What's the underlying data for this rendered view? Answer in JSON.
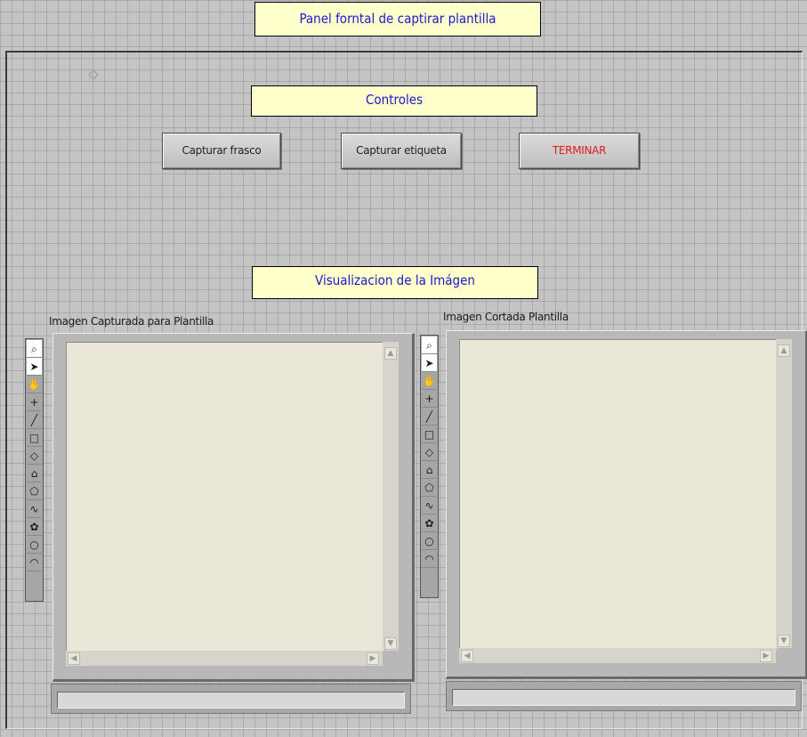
{
  "header": {
    "title": "Panel forntal de captirar plantilla"
  },
  "controls": {
    "section_title": "Controles",
    "buttons": {
      "capture_bottle": "Capturar frasco",
      "capture_label": "Capturar etiqueta",
      "terminate": "TERMINAR"
    },
    "terminate_color": "#e21a1a"
  },
  "visualization": {
    "section_title": "Visualizacion de la Imágen",
    "left_caption": "Imagen Capturada para  Plantilla",
    "right_caption": "Imagen Cortada Plantilla"
  },
  "toolbar_tools": [
    {
      "name": "zoom-icon",
      "glyph": "⌕"
    },
    {
      "name": "select-pointer-icon",
      "glyph": "➤"
    },
    {
      "name": "pan-hand-icon",
      "glyph": "✋"
    },
    {
      "name": "point-icon",
      "glyph": "+"
    },
    {
      "name": "line-icon",
      "glyph": "╱"
    },
    {
      "name": "rectangle-icon",
      "glyph": "□"
    },
    {
      "name": "rotated-rectangle-icon",
      "glyph": "◇"
    },
    {
      "name": "annulus-icon",
      "glyph": "⌂"
    },
    {
      "name": "polygon-icon",
      "glyph": "⬠"
    },
    {
      "name": "freehand-line-icon",
      "glyph": "∿"
    },
    {
      "name": "freehand-region-icon",
      "glyph": "✿"
    },
    {
      "name": "oval-icon",
      "glyph": "○"
    },
    {
      "name": "arc-icon",
      "glyph": "◠"
    }
  ],
  "colors": {
    "label_background": "#ffffcc",
    "label_text": "#1a1acc",
    "canvas_background": "#ebe7d8"
  }
}
